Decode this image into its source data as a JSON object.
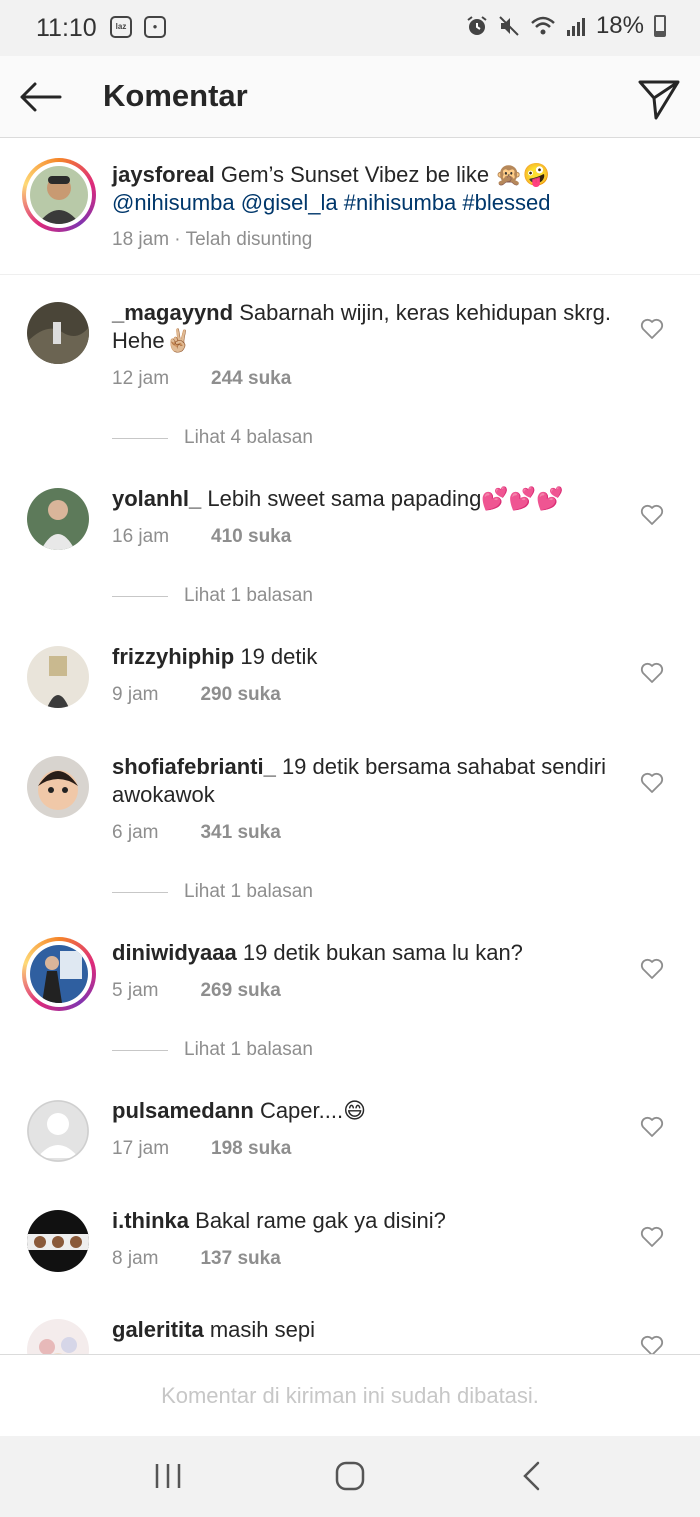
{
  "status_bar": {
    "time": "11:10",
    "lazada_badge": "laz",
    "battery": "18%"
  },
  "header": {
    "title": "Komentar"
  },
  "caption": {
    "username": "jaysforeal",
    "text": "Gem’s Sunset Vibez be like 🙊🤪",
    "mentions": "@nihisumba @gisel_la #nihisumba #blessed",
    "meta": "18 jam · Telah disunting"
  },
  "comments": [
    {
      "username": "_magayynd",
      "text": "Sabarnah wijin, keras kehidupan skrg. Hehe✌🏼",
      "time": "12 jam",
      "likes": "244 suka",
      "replies": "Lihat 4 balasan"
    },
    {
      "username": "yolanhl_",
      "text": "Lebih sweet sama papading💕💕💕",
      "time": "16 jam",
      "likes": "410 suka",
      "replies": "Lihat 1 balasan"
    },
    {
      "username": "frizzyhiphip",
      "text": "19 detik",
      "time": "9 jam",
      "likes": "290 suka"
    },
    {
      "username": "shofiafebrianti_",
      "text": "19 detik bersama sahabat sendiri awokawok",
      "time": "6 jam",
      "likes": "341 suka",
      "replies": "Lihat 1 balasan"
    },
    {
      "username": "diniwidyaaa",
      "text": "19 detik bukan sama lu kan?",
      "time": "5 jam",
      "likes": "269 suka",
      "replies": "Lihat 1 balasan"
    },
    {
      "username": "pulsamedann",
      "text": "Caper....😄",
      "time": "17 jam",
      "likes": "198 suka"
    },
    {
      "username": "i.thinka",
      "text": "Bakal rame gak ya disini?",
      "time": "8 jam",
      "likes": "137 suka"
    },
    {
      "username": "galeritita",
      "text": "masih sepi"
    }
  ],
  "footer": {
    "restricted_text": "Komentar di kiriman ini sudah dibatasi."
  },
  "icons": {
    "back": "arrow-left-icon",
    "send": "paper-plane-icon",
    "heart": "heart-outline-icon",
    "nav_recents": "recents-icon",
    "nav_home": "home-icon",
    "nav_back": "chevron-left-icon"
  },
  "colors": {
    "text": "#262626",
    "secondary": "#8e8e8e",
    "mention": "#00376b",
    "divider": "#dbdbdb"
  }
}
